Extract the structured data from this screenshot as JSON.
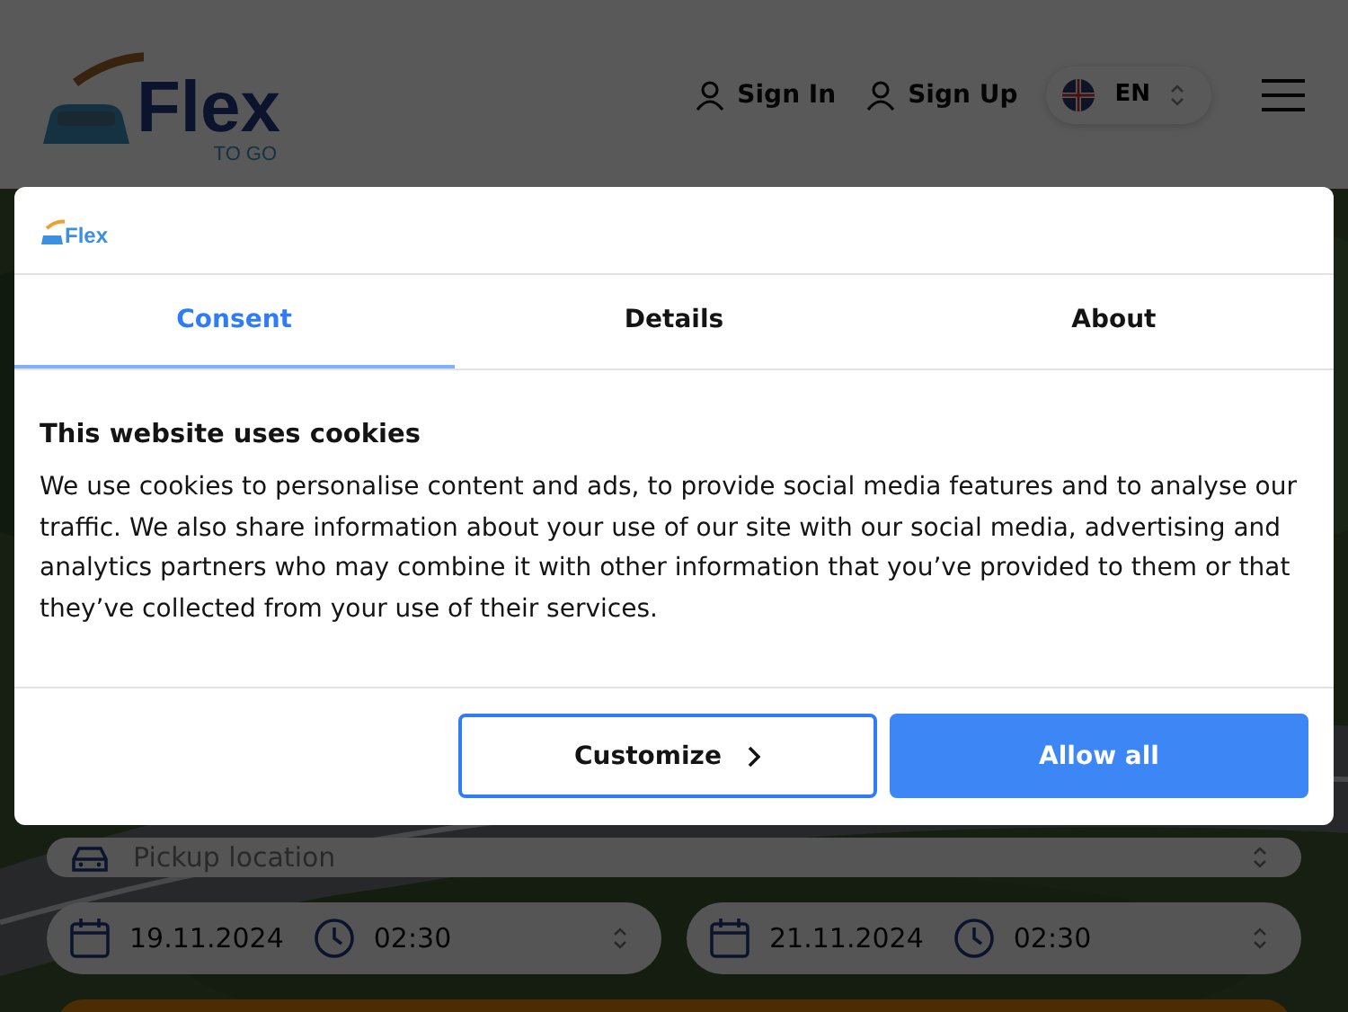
{
  "header": {
    "logo": {
      "word": "Flex",
      "tagline": "TO GO"
    },
    "links": [
      "Sign In",
      "Sign Up"
    ],
    "language": "EN"
  },
  "booking": {
    "pickup": {
      "placeholder": "Pickup location"
    },
    "dates": [
      {
        "date": "19.11.2024",
        "time": "02:30"
      },
      {
        "date": "21.11.2024",
        "time": "02:30"
      }
    ]
  },
  "dialog": {
    "logo": {
      "word": "Flex"
    },
    "tabs": [
      {
        "label": "Consent",
        "selected": true
      },
      {
        "label": "Details",
        "selected": false
      },
      {
        "label": "About",
        "selected": false
      }
    ],
    "heading": "This website uses cookies",
    "body": "We use cookies to personalise content and ads, to provide social media features and to analyse our traffic. We also share information about your use of our site with our social media, advertising and analytics partners who may combine it with other information that you’ve provided to them or that they’ve collected from your use of their services.",
    "buttons": [
      {
        "label": "Customize",
        "kind": "outline"
      },
      {
        "label": "Allow all",
        "kind": "primary"
      }
    ]
  }
}
